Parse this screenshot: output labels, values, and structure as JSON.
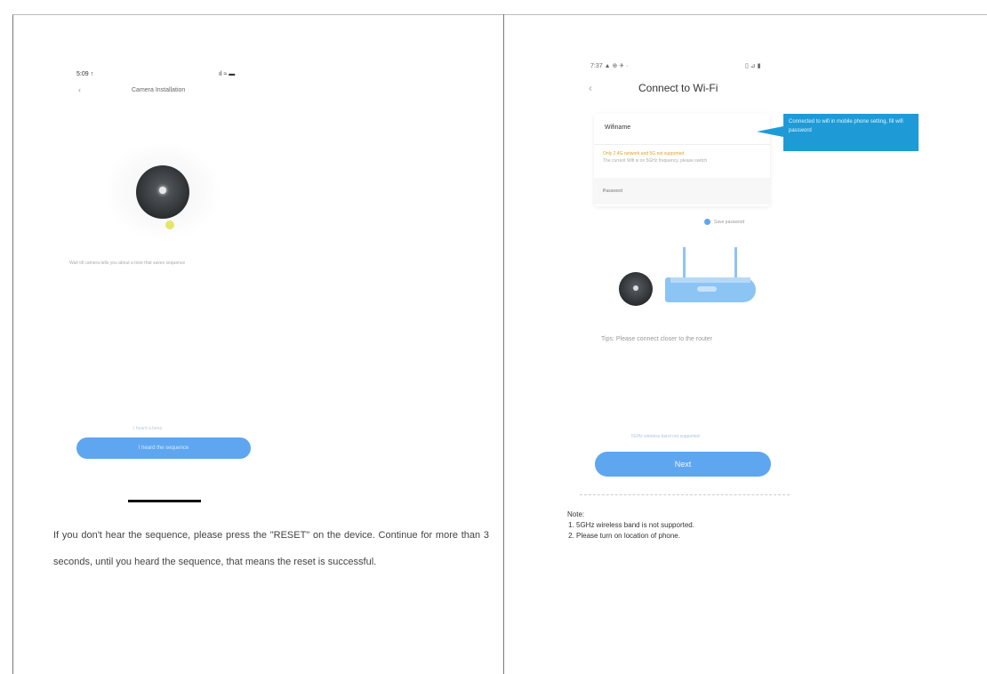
{
  "left_phone": {
    "status_time": "5:09 ↑",
    "status_icons": "ıl ≈ ▬",
    "back_icon": "‹",
    "title": "Camera Installation",
    "hint_text": "Wait till camera tells you about a tone that saves sequence",
    "sub_link": "I heard a beep",
    "button_label": "I heard the sequence"
  },
  "left_paragraph": "If you don't hear the sequence, please press the \"RESET\" on the device. Continue for more than 3 seconds, until you heard the sequence, that means the reset is successful.",
  "right_phone": {
    "status_left": "7:37 ▲ ⊕ ✈ ·",
    "status_right": "▯ ⊿ ▮",
    "back_icon": "‹",
    "title": "Connect to Wi-Fi",
    "ssid": "Wifiname",
    "warning_line1": "Only 2.4G network and 5G not supported",
    "warning_line2": "The current Wifi is on 5GHz frequency, please switch",
    "password_placeholder": "Password",
    "eye_icon": "◌",
    "remember_label": "Save password",
    "router_label": "WiFi",
    "note": "Tips: Please connect closer to the router",
    "sub_link": "5GHz wireless band not supported",
    "next_button": "Next"
  },
  "callout_text": "Connected to wifi in mobile phone setting, fill wifi password",
  "notes": {
    "heading": "Note:",
    "items": [
      "5GHz wireless band is not supported.",
      "Please turn on location of phone."
    ]
  }
}
